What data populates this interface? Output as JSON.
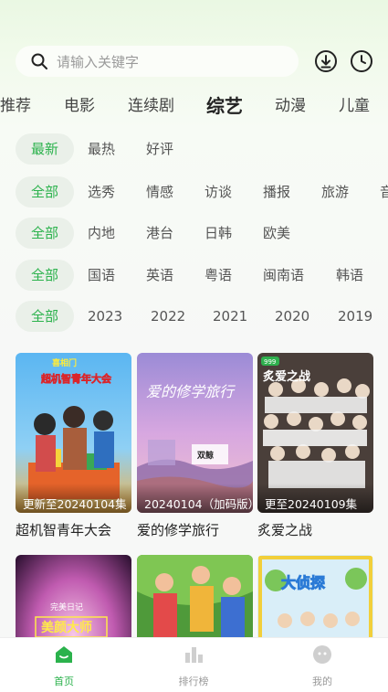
{
  "search": {
    "placeholder": "请输入关键字"
  },
  "header_icons": [
    "download-icon",
    "history-clock-icon"
  ],
  "nav": {
    "tabs": [
      {
        "label": "推荐",
        "active": false
      },
      {
        "label": "电影",
        "active": false
      },
      {
        "label": "连续剧",
        "active": false
      },
      {
        "label": "综艺",
        "active": true
      },
      {
        "label": "动漫",
        "active": false
      },
      {
        "label": "儿童",
        "active": false
      }
    ]
  },
  "filters": {
    "sort": [
      "最新",
      "最热",
      "好评"
    ],
    "type": [
      "全部",
      "选秀",
      "情感",
      "访谈",
      "播报",
      "旅游",
      "音"
    ],
    "region": [
      "全部",
      "内地",
      "港台",
      "日韩",
      "欧美"
    ],
    "language": [
      "全部",
      "国语",
      "英语",
      "粤语",
      "闽南语",
      "韩语"
    ],
    "year": [
      "全部",
      "2023",
      "2022",
      "2021",
      "2020",
      "2019"
    ]
  },
  "cards": [
    {
      "title": "超机智青年大会",
      "caption": "更新至20240104集"
    },
    {
      "title": "爱的修学旅行",
      "caption": "20240104（加码版）"
    },
    {
      "title": "炙爱之战",
      "caption": "更至20240109集"
    },
    {
      "title": "",
      "caption": ""
    },
    {
      "title": "",
      "caption": ""
    },
    {
      "title": "",
      "caption": ""
    }
  ],
  "posters": {
    "p1_brand": "喜相门",
    "p1_show": "超机智青年大会",
    "p2_show": "爱的修学旅行",
    "p2_brand": "双鲸",
    "p3_badge": "999",
    "p3_show": "炙爱之战",
    "p4_show": "美颜大师",
    "p4_brand": "完美日记",
    "p6_show": "大侦探"
  },
  "bottom_nav": [
    {
      "label": "首页",
      "icon": "home-icon",
      "active": true
    },
    {
      "label": "排行榜",
      "icon": "bar-chart-icon",
      "active": false
    },
    {
      "label": "我的",
      "icon": "profile-face-icon",
      "active": false
    }
  ],
  "colors": {
    "accent": "#2bb24c",
    "chip_bg": "#eaf0e9",
    "background": "#f7f8f7"
  }
}
